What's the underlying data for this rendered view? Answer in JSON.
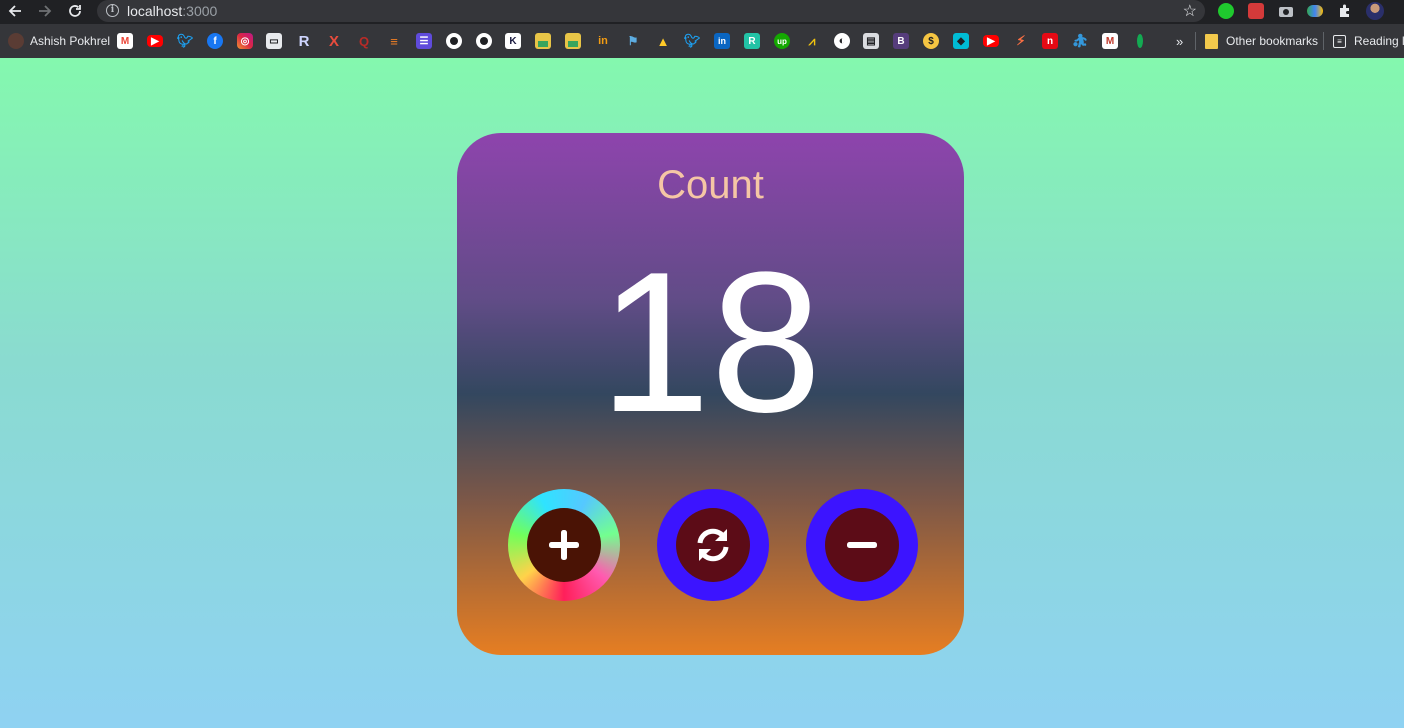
{
  "browser": {
    "url": "localhost",
    "url_port": ":3000",
    "bookmarks": {
      "first": "Ashish Pokhrel",
      "more": "»",
      "other": "Other bookmarks",
      "reading": "Reading li"
    }
  },
  "counter": {
    "title": "Count",
    "value": "18",
    "increment_icon": "plus-icon",
    "reset_icon": "refresh-icon",
    "decrement_icon": "minus-icon"
  },
  "colors": {
    "card_top": "#8e44ad",
    "card_middle": "#33475f",
    "card_bottom": "#e67e22",
    "button_ring": "#3c14ff",
    "button_inner": "#5c0c17"
  }
}
